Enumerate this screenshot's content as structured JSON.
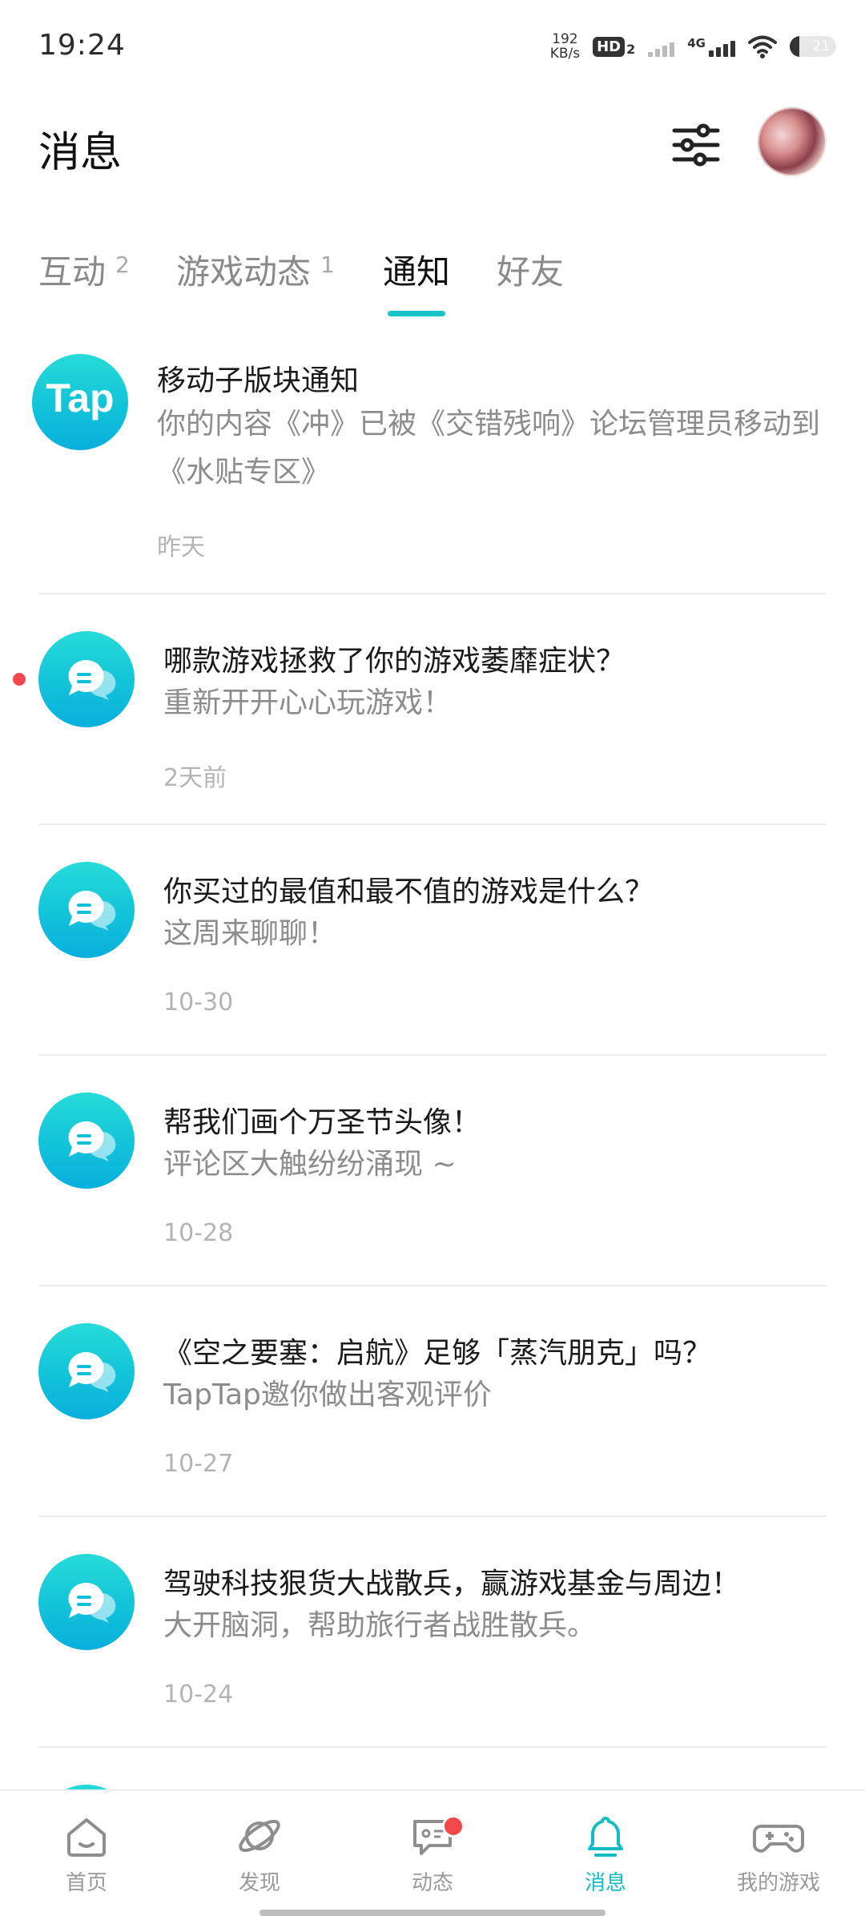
{
  "status_bar": {
    "time": "19:24",
    "net_speed": "192",
    "net_unit": "KB/s",
    "hd": "HD",
    "hd_sub": "2",
    "network_type": "4G",
    "battery": "21",
    "battery_fraction": 0.21
  },
  "header": {
    "title": "消息"
  },
  "tabs": [
    {
      "label": "互动",
      "count": "2"
    },
    {
      "label": "游戏动态",
      "count": "1"
    },
    {
      "label": "通知",
      "count": ""
    },
    {
      "label": "好友",
      "count": ""
    }
  ],
  "notifications": [
    {
      "icon": "tap-logo",
      "icon_text": "Tap",
      "title": "移动子版块通知",
      "desc": "你的内容《冲》已被《交错残响》论坛管理员移动到《水贴专区》",
      "time": "昨天",
      "unread": false
    },
    {
      "icon": "chat-bubble-icon",
      "title": "哪款游戏拯救了你的游戏萎靡症状？",
      "desc": "重新开开心心玩游戏！",
      "time": "2天前",
      "unread": true
    },
    {
      "icon": "chat-bubble-icon",
      "title": "你买过的最值和最不值的游戏是什么？",
      "desc": "这周来聊聊！",
      "time": "10-30",
      "unread": false
    },
    {
      "icon": "chat-bubble-icon",
      "title": "帮我们画个万圣节头像！",
      "desc": "评论区大触纷纷涌现 ~",
      "time": "10-28",
      "unread": false
    },
    {
      "icon": "chat-bubble-icon",
      "title": "《空之要塞：启航》足够「蒸汽朋克」吗？",
      "desc": "TapTap邀你做出客观评价",
      "time": "10-27",
      "unread": false
    },
    {
      "icon": "chat-bubble-icon",
      "title": "驾驶科技狠货大战散兵，赢游戏基金与周边！",
      "desc": "大开脑洞，帮助旅行者战胜散兵。",
      "time": "10-24",
      "unread": false
    }
  ],
  "bottom_nav": [
    {
      "label": "首页",
      "icon": "home-icon"
    },
    {
      "label": "发现",
      "icon": "planet-icon"
    },
    {
      "label": "动态",
      "icon": "chat-icon",
      "badge": true
    },
    {
      "label": "消息",
      "icon": "bell-icon",
      "active": true
    },
    {
      "label": "我的游戏",
      "icon": "gamepad-icon"
    }
  ],
  "colors": {
    "accent": "#14bcc6",
    "badge": "#f2474b",
    "icon_gradient_top": "#27dbd8",
    "icon_gradient_bottom": "#08afdd"
  }
}
